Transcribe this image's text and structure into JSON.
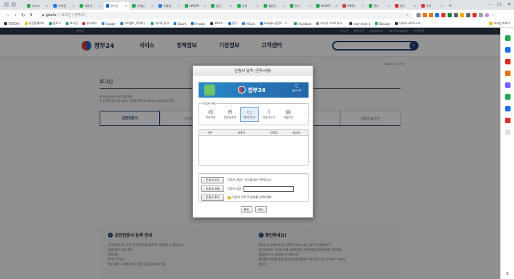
{
  "browser": {
    "tabs": [
      {
        "title": "비즈버",
        "color": "#1fa84f"
      },
      {
        "title": "프로필",
        "color": "#1877f2"
      },
      {
        "title": "지원사",
        "color": "#1fa84f"
      },
      {
        "title": "로그인",
        "color": "#1c66c7",
        "active": true
      },
      {
        "title": "국세청",
        "color": "#1fa84f"
      },
      {
        "title": "국세청",
        "color": "#2b7de0"
      },
      {
        "title": "NAVER",
        "color": "#1fa84f"
      },
      {
        "title": "상상",
        "color": "#1fa84f"
      },
      {
        "title": "상상",
        "color": "#1fa84f"
      },
      {
        "title": "월응인",
        "color": "#1fa84f"
      },
      {
        "title": "인터",
        "color": "#1fa84f"
      },
      {
        "title": "NAVER",
        "color": "#1fa84f"
      },
      {
        "title": "(PHO)",
        "color": "#cc3b3b"
      },
      {
        "title": "관리",
        "color": "#1fa84f"
      },
      {
        "title": "육군",
        "color": "#d93025"
      },
      {
        "title": "후기",
        "color": "#d93025"
      }
    ],
    "new_tab": "+",
    "window_controls": [
      "–",
      "□",
      "✕"
    ],
    "url_host": "gov.kr",
    "url_title": "로그인 | 정부24",
    "bookmarks": [
      "TISTORY",
      "정진홈페이지",
      "블로그",
      "포스팅",
      "워시케이",
      "Google",
      "오지월브_21계기..",
      "네이버 광고",
      "Daum",
      "Freepik",
      "3D프즈",
      "블그",
      "HiCalc",
      "Google 릴린터 - 2...",
      "Facebook",
      "비즈용 스마트워크...",
      "main style a",
      "Bizcube",
      "네이버 스마트스토..."
    ],
    "bookmark_right": "모바일 북마크"
  },
  "site": {
    "util_left": "세인트",
    "util_links": [
      "로그인",
      "회원가입",
      "정부24소개",
      "For Foreigners",
      "사이트맵"
    ],
    "logo": "정부24",
    "menu": [
      "서비스",
      "정책정보",
      "기관정보",
      "고객센터"
    ],
    "breadcrumb": "Home > 로그인",
    "page_title": "로그인",
    "notice_lines": [
      "※ 키보드보안 프로그램 적용",
      "※ 안전한 정부24 서비스 이용을 위해 키보드보안 프로그램 적용..."
    ],
    "login_tabs": [
      "공인인증서",
      "디지털",
      "",
      "인증",
      "비회원로그인"
    ],
    "info": {
      "left_title": "공인인증서 등록 안내",
      "left_items": [
        "공인인증서 로그인은 공인인증서를 등록 후 이용하실 수 있습니다.",
        "공인인증서 등록 절차",
        "회원가입",
        "아이디 로그인",
        "My GOV > 회원정보 > 인증 등록/관리에서 이용"
      ],
      "right_title": "확인하세요!",
      "right_items": [
        "모바일 기기에서 인증서 목록이 보이지 않는 경우 [자세히보기]",
        "공인인증서는 기간은 은행, 증권사에서 인터넷뱅킹 증권거래용 인증서를",
        "발급받으시고 이용하시기 바랍니다.",
        "개인정보 보호를 위해 공인인증서 비밀번호 3회 이상 오류 시 재시도 하셔야",
        "합니다."
      ]
    }
  },
  "dialog": {
    "title": "인증서 입력 (전자서명)",
    "banner_logo": "정부24",
    "banner_domain": "gov.kr",
    "location_label": "인증서 위치",
    "locations": [
      {
        "label": "브라우저",
        "icon": "globe-icon",
        "glyph": "◍"
      },
      {
        "label": "인증서찾기",
        "icon": "search-folder-icon",
        "glyph": "⊕"
      },
      {
        "label": "하드디스크",
        "icon": "monitor-icon",
        "glyph": "▭",
        "selected": true
      },
      {
        "label": "이동디스크",
        "icon": "usb-icon",
        "glyph": "⌷"
      },
      {
        "label": "저장토큰",
        "icon": "token-icon",
        "glyph": "▤"
      }
    ],
    "columns": [
      "구분",
      "사용자",
      "만료일",
      "발급자"
    ],
    "actions": [
      {
        "button": "인증서 보기",
        "text": "인증서 정보는 더스플까봐 구분합니다."
      },
      {
        "button": "인증서 삭제",
        "text": "인증서 암호"
      },
      {
        "button": "인증서 찾기",
        "text": "인증서 선택 후 암호를 입력하세요."
      }
    ],
    "ok": "확인",
    "cancel": "취소"
  },
  "colors": {
    "navy": "#1e3c78",
    "banner_blue": "#2466a8",
    "dim_overlay": "rgba(0,0,0,0.42)"
  }
}
